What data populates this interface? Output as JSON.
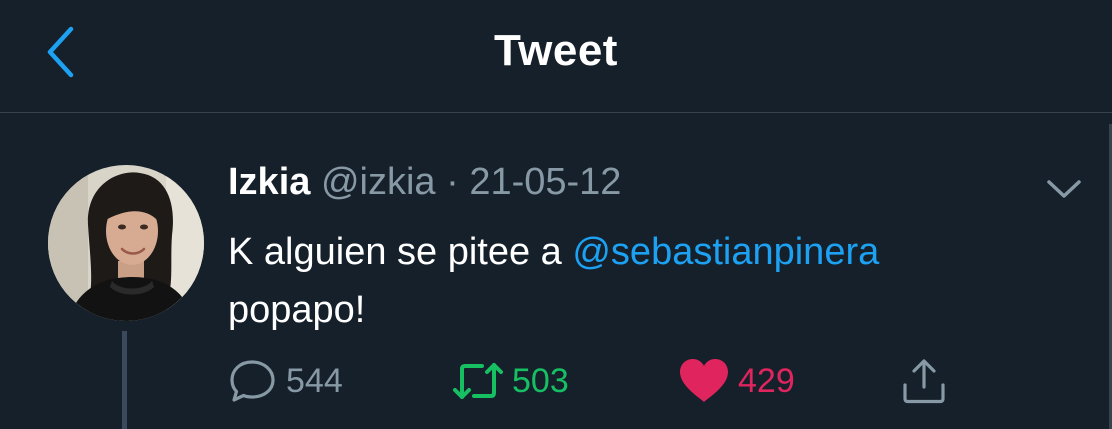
{
  "header": {
    "title": "Tweet",
    "back_icon": "chevron-left-icon"
  },
  "tweet": {
    "display_name": "Izkia",
    "handle": "@izkia",
    "separator": "·",
    "date": "21-05-12",
    "text_before": "K alguien se pitee a ",
    "mention": "@sebastianpinera",
    "text_after": "popapo!",
    "more_icon": "chevron-down-icon"
  },
  "actions": {
    "reply_count": "544",
    "retweet_count": "503",
    "like_count": "429"
  },
  "colors": {
    "background": "#15202b",
    "accent_blue": "#1da1f2",
    "retweet_green": "#17bf63",
    "like_red": "#e0245e",
    "muted": "#8899a6",
    "divider": "#38444d"
  }
}
